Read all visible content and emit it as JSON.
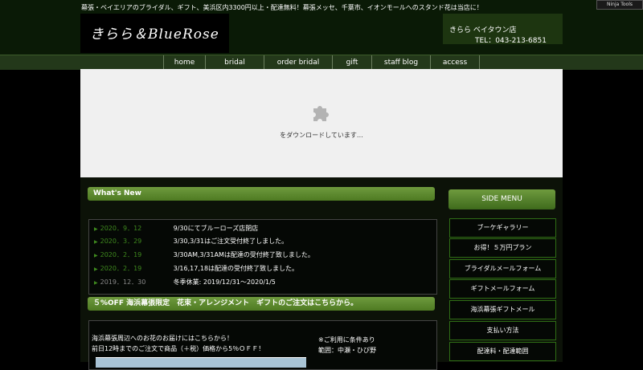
{
  "header": {
    "tagline": "幕張・ベイエリアのブライダル、ギフト、美浜区内3300円以上・配達無料！幕張メッセ、千葉市、イオンモールへのスタンド花は当店に！",
    "logo_text": "きらら＆BlueRose",
    "shop_name": "きらら ベイタウン店",
    "shop_tel": "TEL：043-213-6851",
    "ninja_label": "Ninja Tools"
  },
  "nav": {
    "items": [
      {
        "label": "home"
      },
      {
        "label": "bridal"
      },
      {
        "label": "order bridal"
      },
      {
        "label": "gift"
      },
      {
        "label": "staff blog"
      },
      {
        "label": "access"
      }
    ]
  },
  "plugin": {
    "icon": "puzzle-piece-icon",
    "message": "をダウンロードしています…"
  },
  "whats_new": {
    "title": "What's New",
    "items": [
      {
        "date": "2020．9．12",
        "text": "9/30にてブルーローズ店閉店"
      },
      {
        "date": "2020．3．29",
        "text": "3/30,3/31はご注文受付終了しました。"
      },
      {
        "date": "2020．2．19",
        "text": "3/30AM,3/31AMは配達の受付終了致しました。"
      },
      {
        "date": "2020．2．19",
        "text": "3/16,17,18は配達の受付終了致しました。"
      },
      {
        "date": "2019．12．30",
        "text": "冬季休業: 2019/12/31～2020/1/5"
      }
    ]
  },
  "promo": {
    "title": "５%OFF 海浜幕張限定　花束・アレンジメント　ギフトのご注文はこちらから。",
    "line1": "海浜幕張周辺へのお花のお届けにはこちらから！",
    "line2": "前日12時までのご注文で商品（＋税）価格から5％ＯＦＦ！",
    "note1": "※ご利用に条件あり",
    "note2": "範囲：中瀬・ひび野"
  },
  "side_menu": {
    "title": "SIDE MENU",
    "items": [
      {
        "label": "ブーケギャラリー"
      },
      {
        "label": "お得！５万円プラン"
      },
      {
        "label": "ブライダルメールフォーム"
      },
      {
        "label": "ギフトメールフォーム"
      },
      {
        "label": "海浜幕張ギフトメール"
      },
      {
        "label": "支払い方法"
      },
      {
        "label": "配達料・配達範囲"
      }
    ]
  },
  "colors": {
    "accent_green": "#4e7a22",
    "date_green": "#3f8a1e",
    "header_bg": "#0a1a06"
  }
}
